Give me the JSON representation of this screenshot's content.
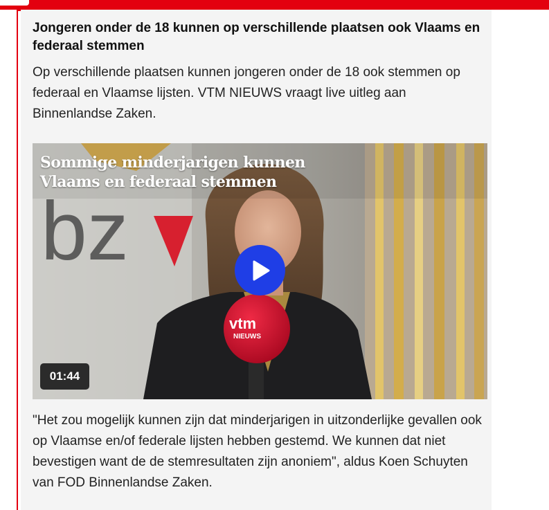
{
  "article": {
    "headline": "Jongeren onder de 18 kunnen op verschillende plaatsen ook Vlaams en federaal stemmen",
    "intro": "Op verschillende plaatsen kunnen jongeren onder de 18 ook stemmen op federaal en Vlaamse lijsten. VTM NIEUWS vraagt live uitleg aan Binnenlandse Zaken.",
    "quote": "\"Het zou mogelijk kunnen zijn dat minderjarigen in uitzonderlijke gevallen ook op Vlaamse en/of federale lijsten hebben gestemd. We kunnen dat niet bevestigen want de de stemresultaten zijn anoniem\", aldus Koen Schuyten van FOD Binnenlandse Zaken."
  },
  "video": {
    "overlay_title": "Sommige minderjarigen kunnen Vlaams en federaal stemmen",
    "duration": "01:44",
    "background_logo_text": "bz",
    "microphone_logo_text": "vtm",
    "microphone_logo_subtext": "NIEUWS"
  },
  "colors": {
    "accent_red": "#e3000f",
    "play_button_blue": "#1f3ee6",
    "card_background": "#f4f4f4"
  }
}
